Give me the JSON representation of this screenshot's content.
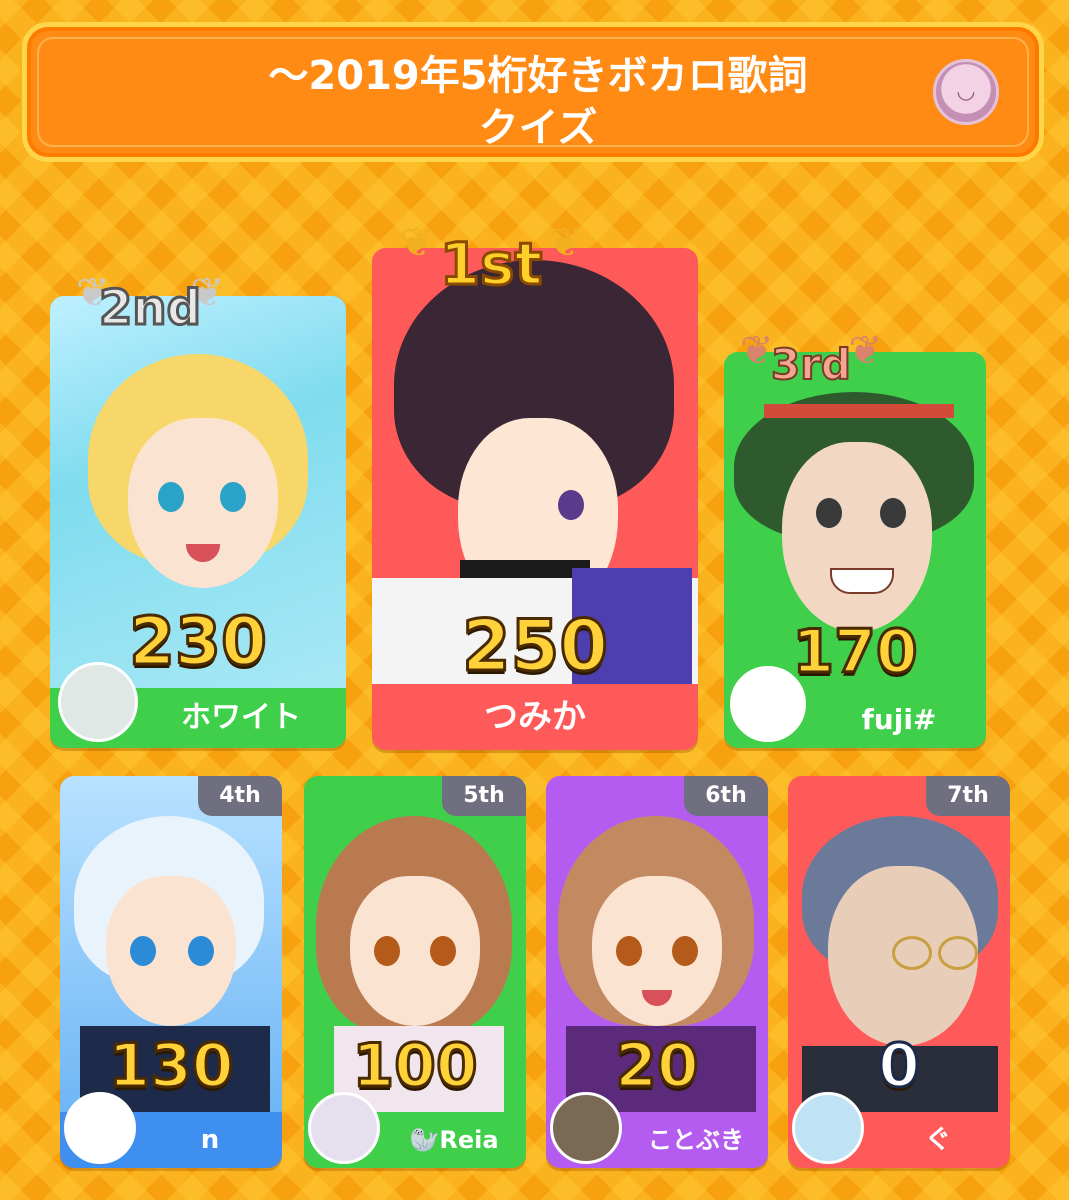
{
  "header": {
    "title_line1": "～2019年5桁好きボカロ歌詞",
    "title_line2": "クイズ"
  },
  "podium": [
    {
      "rank": "1st",
      "score": "250",
      "name": "つみか",
      "color": "#ff5a5a"
    },
    {
      "rank": "2nd",
      "score": "230",
      "name": "ホワイト",
      "color": "#3fcf4a"
    },
    {
      "rank": "3rd",
      "score": "170",
      "name": "fuji#",
      "color": "#3fcf4a"
    }
  ],
  "others": [
    {
      "rank": "4th",
      "score": "130",
      "name": "n",
      "color": "#3f8ff0"
    },
    {
      "rank": "5th",
      "score": "100",
      "name": "🦭Reia",
      "color": "#3fcf4a"
    },
    {
      "rank": "6th",
      "score": "20",
      "name": "ことぶき",
      "color": "#b55cf0"
    },
    {
      "rank": "7th",
      "score": "0",
      "name": "ぐ",
      "color": "#ff5a5a"
    }
  ],
  "colors": {
    "background": "#f7a10f",
    "banner": "#ff8a14",
    "score_text": "#ffd23a",
    "rank_tag": "#6f6f80"
  },
  "icons": [
    "laurel-gold-icon",
    "laurel-silver-icon",
    "laurel-bronze-icon"
  ]
}
